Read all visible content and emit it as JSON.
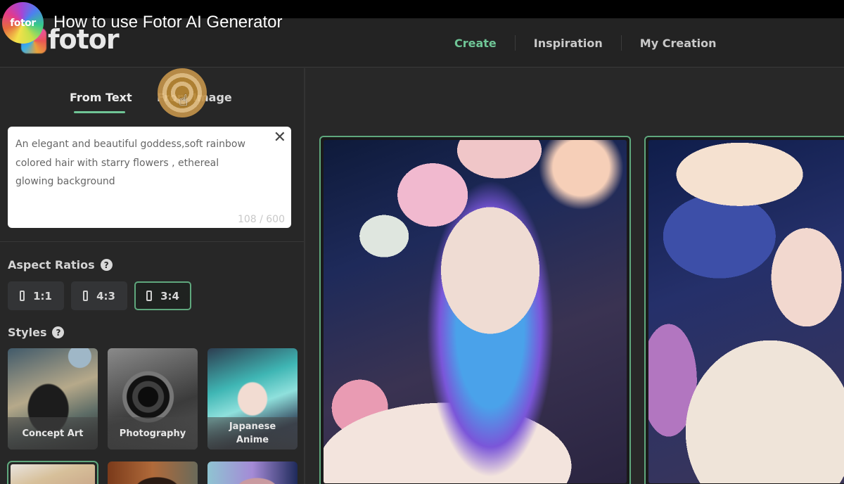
{
  "video": {
    "channel_avatar_text": "fotor",
    "title": "How to use Fotor AI Generator"
  },
  "header": {
    "logo_text": "fotor",
    "nav": [
      {
        "label": "Create",
        "active": true
      },
      {
        "label": "Inspiration",
        "active": false
      },
      {
        "label": "My Creation",
        "active": false
      }
    ]
  },
  "sidebar": {
    "mode_tabs": [
      {
        "label": "From Text",
        "active": true
      },
      {
        "label": "From Image",
        "active": false
      }
    ],
    "prompt": {
      "value": "An elegant and beautiful goddess,soft rainbow\ncolored hair with starry flowers , ethereal\nglowing background",
      "char_count": "108 / 600",
      "clear_icon": "close-icon"
    },
    "aspect_ratios": {
      "label": "Aspect Ratios",
      "help_icon": "?",
      "options": [
        {
          "label": "1:1",
          "selected": false
        },
        {
          "label": "4:3",
          "selected": false
        },
        {
          "label": "3:4",
          "selected": true
        }
      ]
    },
    "styles": {
      "label": "Styles",
      "help_icon": "?",
      "items": [
        {
          "label": "Concept Art"
        },
        {
          "label": "Photography"
        },
        {
          "label": "Japanese Anime"
        }
      ]
    }
  },
  "colors": {
    "accent": "#6fc596",
    "selected_border": "#5fa87d",
    "background": "#282828",
    "header_bg": "#232323"
  }
}
